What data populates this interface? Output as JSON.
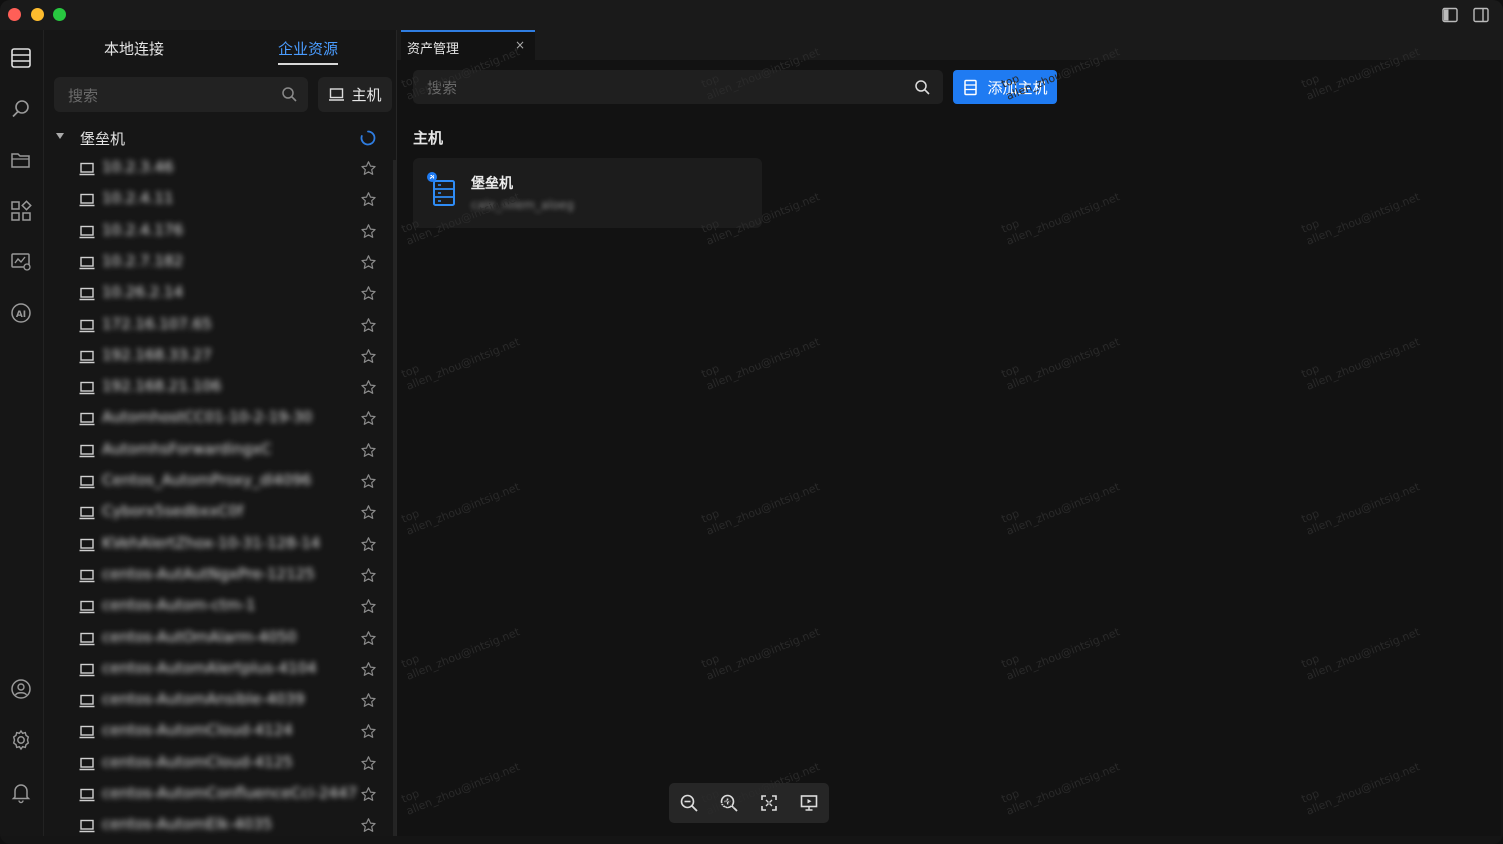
{
  "sidebar": {
    "tabs": [
      {
        "label": "本地连接",
        "active": false
      },
      {
        "label": "企业资源",
        "active": true
      }
    ],
    "search_placeholder": "搜索",
    "host_filter_label": "主机",
    "tree": {
      "root_label": "堡垒机",
      "items": [
        "10.2.3.46",
        "10.2.4.11",
        "10.2.4.176",
        "10.2.7.182",
        "10.26.2.14",
        "172.16.107.65",
        "192.168.33.27",
        "192.168.21.106",
        "AutomhostCC01-10-2-19-30",
        "AutomhsForwardingxC",
        "Centos_AutomProxy_dl4096",
        "Cyborx5sedbxxC0f",
        "KVehAlertZhox-10-31-128-14",
        "centos-AutAutNgxPre-12125",
        "centos-Autom-ctm-1",
        "centos-AutOmAlarm-4050",
        "centos-AutomAlertplus-4104",
        "centos-AutomAnsible-4039",
        "centos-AutomCloud-4124",
        "centos-AutomCloud-4125",
        "centos-AutomConfluenceCci-2447",
        "centos-AutomElk-4035"
      ]
    }
  },
  "tab": {
    "label": "资产管理",
    "close": "×"
  },
  "main": {
    "search_placeholder": "搜索",
    "add_button_label": "添加主机",
    "section_title": "主机",
    "card": {
      "title": "堡垒机",
      "subtitle": "cale_nilem_aloeg"
    }
  },
  "watermark": {
    "line1": "top",
    "line2": "allen_zhou@intsig.net"
  },
  "colors": {
    "accent": "#1f7bf2",
    "active_tab_text": "#4a9cff",
    "background": "#121212"
  },
  "icons": {
    "hosts": "server-list-icon",
    "search": "search-icon",
    "folder": "folder-icon",
    "apps": "apps-grid-icon",
    "monitor": "monitor-icon",
    "ai": "ai-icon",
    "user": "user-icon",
    "settings": "gear-icon",
    "bell": "bell-icon"
  }
}
